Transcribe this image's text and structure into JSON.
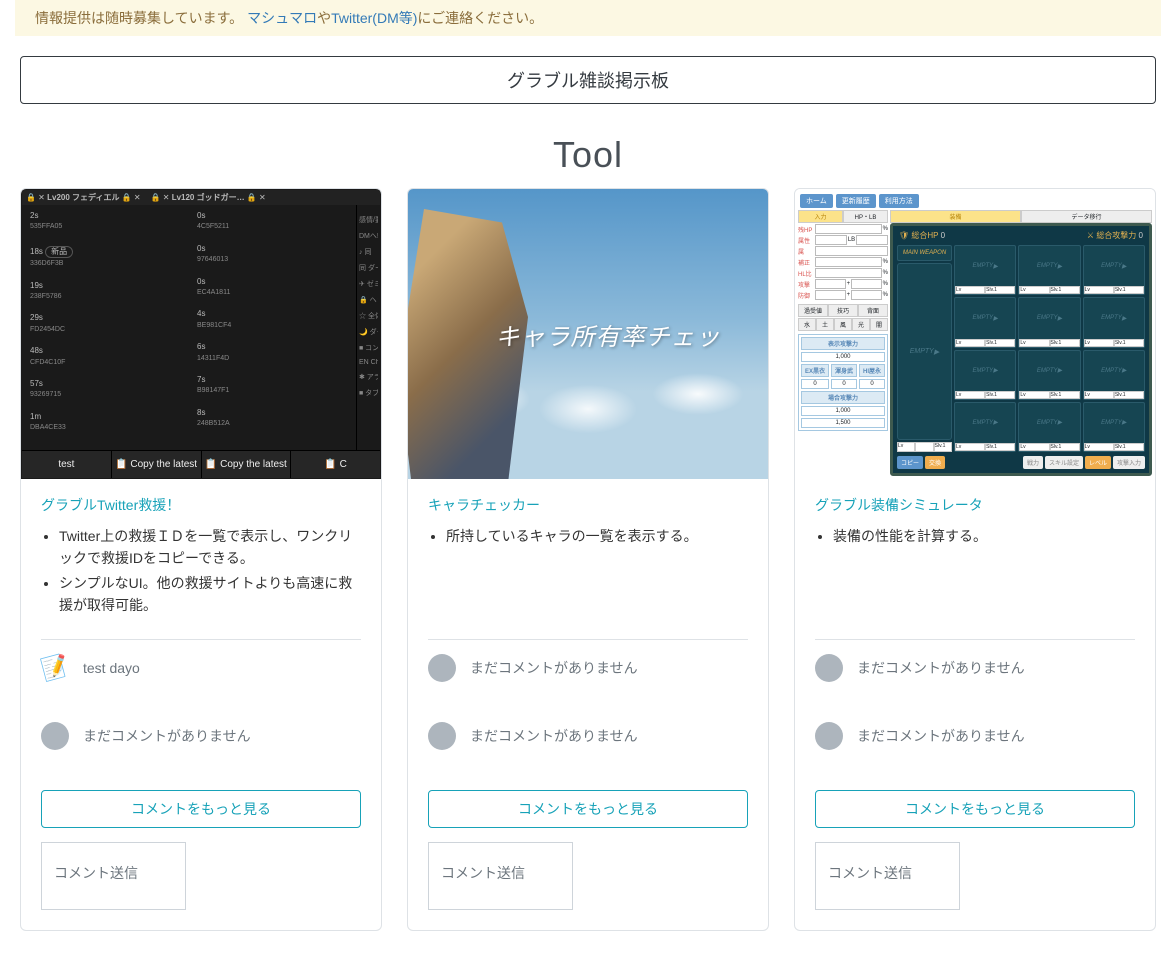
{
  "banner": {
    "prefix": "情報提供は随時募集しています。",
    "link1": "マシュマロ",
    "link_sep": "や",
    "link2": "Twitter(DM等)",
    "suffix": "にご連絡ください。"
  },
  "main_button": "グラブル雑談掲示板",
  "section_title": "Tool",
  "thumb1": {
    "header1": "Lv200 フェディエル",
    "header2": "Lv120 ゴッドガー…",
    "col1": [
      {
        "t": "2s",
        "s": "535FFA05"
      },
      {
        "t": "18s",
        "s": "336D6F3B",
        "tag": "新品"
      },
      {
        "t": "19s",
        "s": "238F5786"
      },
      {
        "t": "29s",
        "s": "FD2454DC"
      },
      {
        "t": "48s",
        "s": "CFD4C10F"
      },
      {
        "t": "57s",
        "s": "93269715"
      },
      {
        "t": "1m",
        "s": "DBA4CE33"
      }
    ],
    "col2": [
      {
        "t": "0s",
        "s": "4C5F5211"
      },
      {
        "t": "0s",
        "s": "97646013"
      },
      {
        "t": "0s",
        "s": "EC4A1811"
      },
      {
        "t": "4s",
        "s": "BE981CF4"
      },
      {
        "t": "6s",
        "s": "14311F4D"
      },
      {
        "t": "7s",
        "s": "B98147F1"
      },
      {
        "t": "8s",
        "s": "248B512A"
      }
    ],
    "side": {
      "a": "感情/要望",
      "b": "DMへ!",
      "c": "♪ 同",
      "d": "同 ダー",
      "e": "✈ ゼミ",
      "f": "🔒 ヘッ",
      "g": "☆ 全体",
      "h": "🌙 ダー",
      "i": "■ コン",
      "j": "EN Cha",
      "k": "✱ アラ",
      "l": "■ タブ"
    },
    "foot_latest": "test",
    "foot_copy": "Copy the latest"
  },
  "thumb2_overlay": "キャラ所有率チェッ",
  "thumb3": {
    "top": [
      "ホーム",
      "更新履歴",
      "利用方法"
    ],
    "tab_left": [
      "入力",
      "HP・LB"
    ],
    "tab_right": [
      "装備",
      "データ移行"
    ],
    "left_labels": [
      "残HP",
      "属性",
      "属",
      "補正",
      "HL比",
      "攻撃",
      "防御"
    ],
    "stat_hdr": [
      "過受値",
      "技巧",
      "背面"
    ],
    "stat_sub": [
      "水",
      "土",
      "風",
      "光",
      "闇"
    ],
    "stat_lbl1": "表示攻撃力",
    "stat_val1": "1,000",
    "stat_hdr2": [
      "EX黒衣",
      "渾身武",
      "HI屋永"
    ],
    "stat_lbl2": "場合攻撃力",
    "stat_vals": [
      "1,000",
      "1,500"
    ],
    "right_hdr1": "総合HP",
    "right_val1": "0",
    "right_hdr2": "総合攻撃力",
    "right_val2": "0",
    "main_lbl": "MAIN WEAPON",
    "empty": "EMPTY",
    "slv": "Slv.1",
    "lv": "Lv",
    "foot": [
      "コピー",
      "交換",
      "戦力",
      "スキル設定",
      "レベル",
      "攻撃入力"
    ]
  },
  "cards": [
    {
      "title": "グラブルTwitter救援！",
      "desc": [
        "Twitter上の救援ＩＤを一覧で表示し、ワンクリックで救援IDをコピーできる。",
        "シンプルなUI。他の救援サイトよりも高速に救援が取得可能。"
      ],
      "comments": [
        {
          "icon": "note",
          "text": "test dayo"
        },
        {
          "icon": "ph",
          "text": "まだコメントがありません"
        }
      ]
    },
    {
      "title": "キャラチェッカー",
      "desc": [
        "所持しているキャラの一覧を表示する。"
      ],
      "comments": [
        {
          "icon": "ph",
          "text": "まだコメントがありません"
        },
        {
          "icon": "ph",
          "text": "まだコメントがありません"
        }
      ]
    },
    {
      "title": "グラブル装備シミュレータ",
      "desc": [
        "装備の性能を計算する。"
      ],
      "comments": [
        {
          "icon": "ph",
          "text": "まだコメントがありません"
        },
        {
          "icon": "ph",
          "text": "まだコメントがありません"
        }
      ]
    }
  ],
  "more_label": "コメントをもっと見る",
  "input_placeholder": "コメント送信"
}
